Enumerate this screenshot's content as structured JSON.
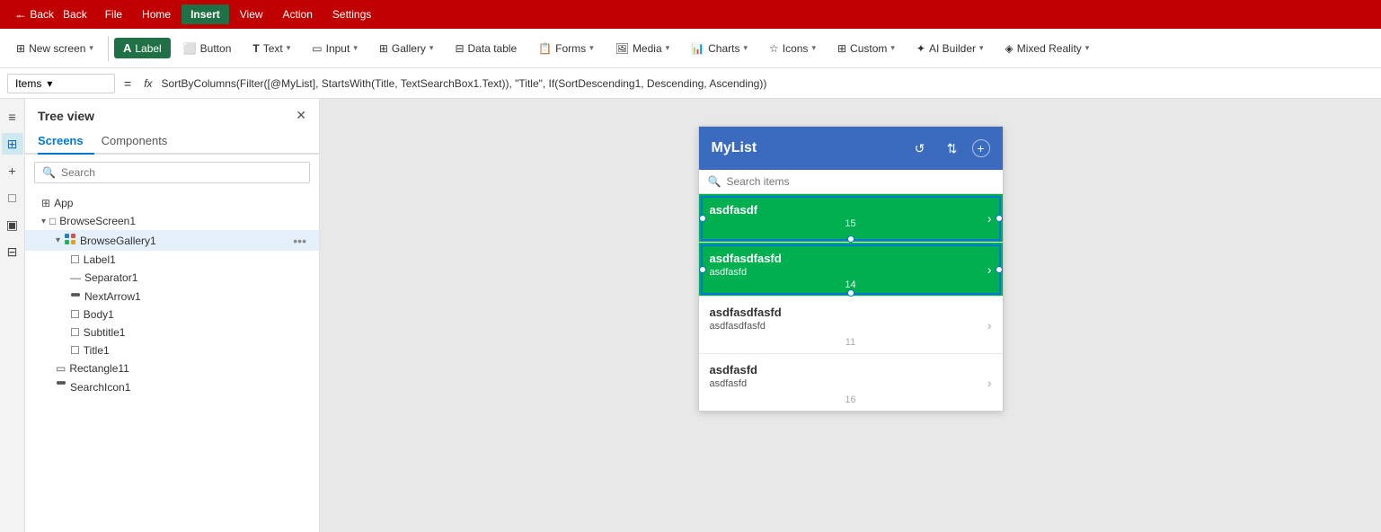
{
  "menubar": {
    "back_label": "← Back",
    "items": [
      "File",
      "Home",
      "Insert",
      "View",
      "Action",
      "Settings"
    ],
    "active_item": "Insert"
  },
  "toolbar": {
    "new_screen_label": "New screen",
    "label_btn": "Label",
    "button_btn": "Button",
    "text_btn": "Text",
    "input_btn": "Input",
    "gallery_btn": "Gallery",
    "datatable_btn": "Data table",
    "forms_btn": "Forms",
    "media_btn": "Media",
    "charts_btn": "Charts",
    "icons_btn": "Icons",
    "custom_btn": "Custom",
    "aibuilder_btn": "AI Builder",
    "mixedreality_btn": "Mixed Reality"
  },
  "formula_bar": {
    "dropdown_label": "Items",
    "equals": "=",
    "fx": "fx",
    "formula": "SortByColumns(Filter([@MyList], StartsWith(Title, TextSearchBox1.Text)), \"Title\", If(SortDescending1, Descending, Ascending))"
  },
  "tree_view": {
    "title": "Tree view",
    "tabs": [
      "Screens",
      "Components"
    ],
    "active_tab": "Screens",
    "search_placeholder": "Search",
    "items": [
      {
        "label": "App",
        "icon": "grid",
        "indent": 0,
        "type": "app"
      },
      {
        "label": "BrowseScreen1",
        "icon": "screen",
        "indent": 0,
        "type": "screen",
        "expanded": true
      },
      {
        "label": "BrowseGallery1",
        "icon": "gallery",
        "indent": 1,
        "type": "gallery",
        "expanded": true,
        "has_more": true
      },
      {
        "label": "Label1",
        "icon": "label",
        "indent": 2,
        "type": "label"
      },
      {
        "label": "Separator1",
        "icon": "separator",
        "indent": 2,
        "type": "separator"
      },
      {
        "label": "NextArrow1",
        "icon": "arrow",
        "indent": 2,
        "type": "arrow"
      },
      {
        "label": "Body1",
        "icon": "label",
        "indent": 2,
        "type": "label"
      },
      {
        "label": "Subtitle1",
        "icon": "label",
        "indent": 2,
        "type": "label"
      },
      {
        "label": "Title1",
        "icon": "label",
        "indent": 2,
        "type": "label"
      },
      {
        "label": "Rectangle11",
        "icon": "rect",
        "indent": 1,
        "type": "rectangle"
      },
      {
        "label": "SearchIcon1",
        "icon": "search",
        "indent": 1,
        "type": "icon"
      }
    ]
  },
  "canvas": {
    "mylist": {
      "title": "MyList",
      "search_placeholder": "Search items",
      "gallery_items": [
        {
          "title": "asdfasdf",
          "subtitle": "",
          "num": "15",
          "selected": true
        },
        {
          "title": "asdfasdfasfd",
          "subtitle": "asdfasfd",
          "num": "14",
          "selected": false,
          "selected2": true
        },
        {
          "title": "asdfasdfasfd",
          "subtitle": "asdfasdfasfd",
          "num": "11",
          "selected": false
        },
        {
          "title": "asdfasfd",
          "subtitle": "asdfasfd",
          "num": "16",
          "selected": false
        }
      ]
    }
  },
  "sidebar_icons": [
    "≡",
    "⊞",
    "+",
    "□",
    "▣",
    "⊟"
  ]
}
